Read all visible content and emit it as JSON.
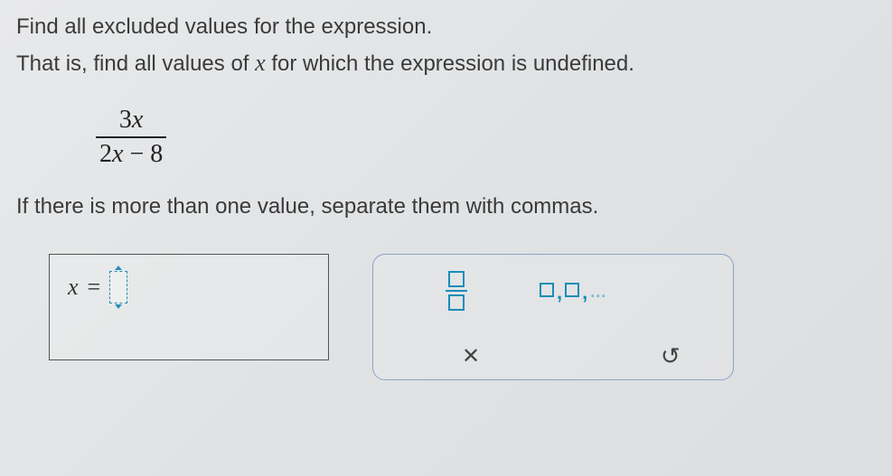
{
  "question": {
    "line1": "Find all excluded values for the expression.",
    "line2_pre": "That is, find all values of ",
    "line2_var": "x",
    "line2_post": " for which the expression is undefined."
  },
  "expression": {
    "numerator": "3x",
    "denominator": "2x − 8"
  },
  "instruction": "If there is more than one value, separate them with commas.",
  "answer": {
    "var": "x",
    "equals": "="
  },
  "toolbox": {
    "list_dots": "...",
    "clear": "✕",
    "undo": "↻"
  }
}
